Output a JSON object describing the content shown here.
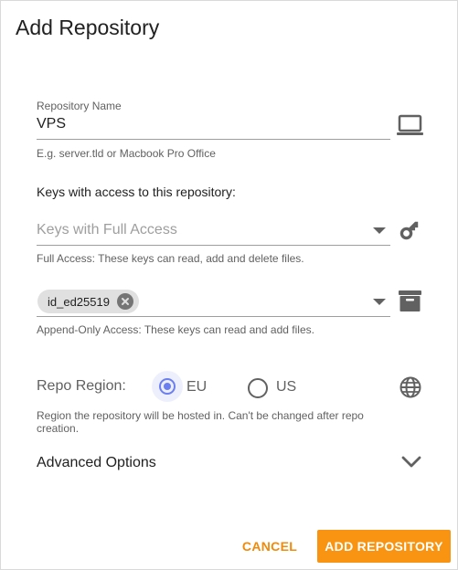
{
  "dialog": {
    "title": "Add Repository"
  },
  "repo_name": {
    "label": "Repository Name",
    "value": "VPS",
    "hint": "E.g. server.tld or Macbook Pro Office",
    "icon": "laptop-icon"
  },
  "keys": {
    "section_title": "Keys with access to this repository:",
    "full_access": {
      "placeholder": "Keys with Full Access",
      "hint": "Full Access: These keys can read, add and delete files.",
      "icon": "key-icon"
    },
    "append_only": {
      "chips": [
        "id_ed25519"
      ],
      "hint": "Append-Only Access: These keys can read and add files.",
      "icon": "archive-icon"
    }
  },
  "region": {
    "label": "Repo Region:",
    "options": [
      {
        "label": "EU",
        "selected": true
      },
      {
        "label": "US",
        "selected": false
      }
    ],
    "hint_line1": "Region the repository will be hosted in. Can't be changed after repo",
    "hint_line2": "creation.",
    "icon": "globe-icon"
  },
  "advanced": {
    "label": "Advanced Options",
    "icon": "chevron-down-icon"
  },
  "actions": {
    "cancel": "CANCEL",
    "submit": "ADD REPOSITORY"
  },
  "colors": {
    "accent": "#f99412",
    "radio_selected": "#6b7ff0"
  }
}
